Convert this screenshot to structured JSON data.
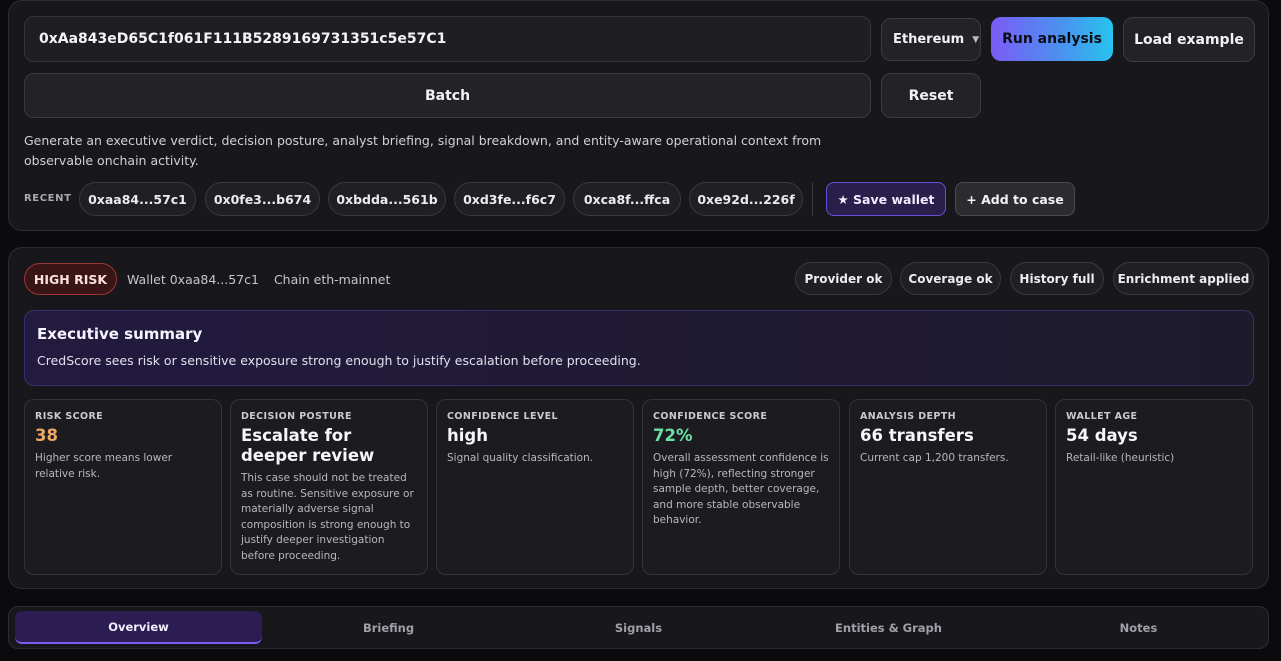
{
  "search": {
    "address": "0xAa843eD65C1f061F111B5289169731351c5e57C1",
    "chain": "Ethereum",
    "run_label": "Run analysis",
    "load_example_label": "Load example",
    "batch_label": "Batch",
    "reset_label": "Reset",
    "description": "Generate an executive verdict, decision posture, analyst briefing, signal breakdown, and entity-aware operational context from observable onchain activity."
  },
  "recent": {
    "label": "RECENT",
    "items": [
      "0xaa84...57c1",
      "0x0fe3...b674",
      "0xbdda...561b",
      "0xd3fe...f6c7",
      "0xca8f...ffca",
      "0xe92d...226f"
    ],
    "save_label": "★ Save wallet",
    "add_case_label": "+ Add to case"
  },
  "result": {
    "risk_badge": "HIGH RISK",
    "wallet": "Wallet 0xaa84...57c1",
    "chain": "Chain eth-mainnet",
    "statuses": [
      "Provider ok",
      "Coverage ok",
      "History full",
      "Enrichment applied"
    ],
    "summary_title": "Executive summary",
    "summary_text": "CredScore sees risk or sensitive exposure strong enough to justify escalation before proceeding.",
    "metrics": [
      {
        "label": "RISK SCORE",
        "value": "38",
        "desc": "Higher score means lower relative risk."
      },
      {
        "label": "DECISION POSTURE",
        "value": "Escalate for deeper review",
        "desc": "This case should not be treated as routine. Sensitive exposure or materially adverse signal composition is strong enough to justify deeper investigation before proceeding."
      },
      {
        "label": "CONFIDENCE LEVEL",
        "value": "high",
        "desc": "Signal quality classification."
      },
      {
        "label": "CONFIDENCE SCORE",
        "value": "72%",
        "desc": "Overall assessment confidence is high (72%), reflecting stronger sample depth, better coverage, and more stable observable behavior."
      },
      {
        "label": "ANALYSIS DEPTH",
        "value": "66 transfers",
        "desc": "Current cap 1,200 transfers."
      },
      {
        "label": "WALLET AGE",
        "value": "54 days",
        "desc": "Retail-like (heuristic)"
      }
    ]
  },
  "tabs": [
    "Overview",
    "Briefing",
    "Signals",
    "Entities & Graph",
    "Notes"
  ],
  "colors": {
    "accent": "#7b5cf6",
    "risk": "#9a3538",
    "risk_score": "#f0a866",
    "confidence_score": "#6ee0a4"
  }
}
